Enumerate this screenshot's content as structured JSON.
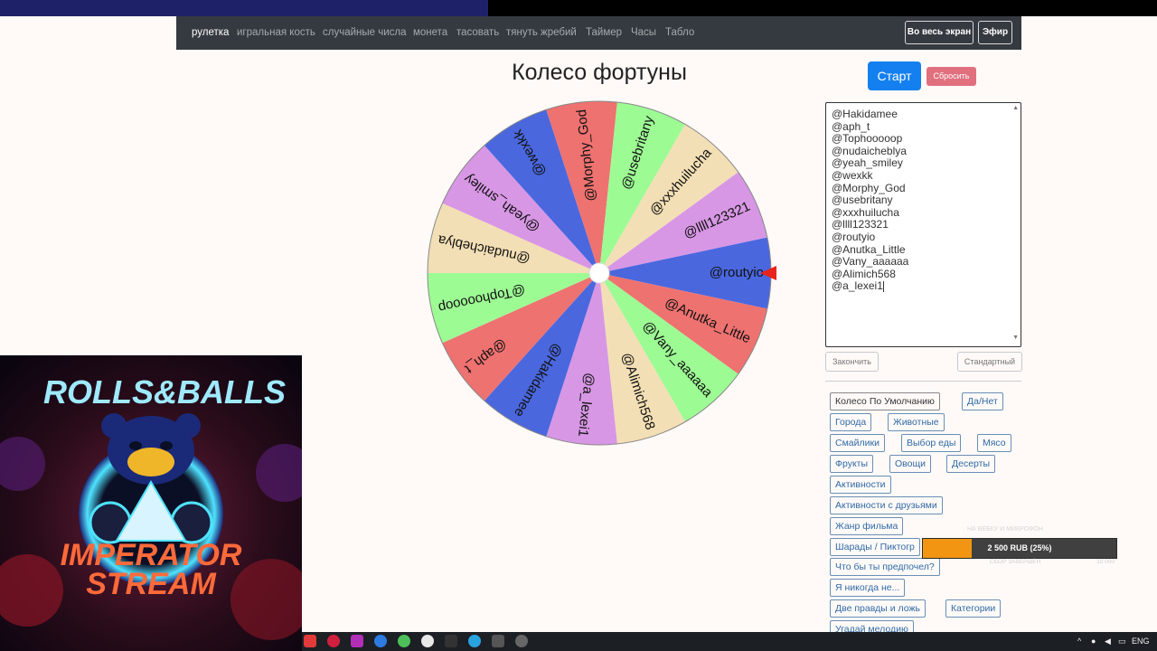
{
  "nav": {
    "items": [
      "рулетка",
      "игральная кость",
      "случайные числа",
      "монета",
      "тасовать",
      "тянуть жребий",
      "Таймер",
      "Часы",
      "Табло"
    ],
    "fullscreen_label": "Во весь экран",
    "broadcast_label": "Эфир"
  },
  "page": {
    "title": "Колесо фортуны"
  },
  "controls": {
    "start_label": "Старт",
    "reset_label": "Сбросить"
  },
  "names": [
    "@Hakidamee",
    "@aph_t",
    "@Tophooooop",
    "@nudaicheblya",
    "@yeah_smiley",
    "@wexkk",
    "@Morphy_God",
    "@usebritany",
    "@xxxhuilucha",
    "@llll123321",
    "@routyio",
    "@Anutka_Little",
    "@Vany_aaaaaa",
    "@Alimich568",
    "@a_lexei1"
  ],
  "actions": {
    "finish_label": "Закончить",
    "standard_label": "Стандартный"
  },
  "presets": [
    "Колесо По Умолчанию",
    "Да/Нет",
    "Города",
    "Животные",
    "Смайлики",
    "Выбор еды",
    "Мясо",
    "Фрукты",
    "Овощи",
    "Десерты",
    "Активности",
    "Активности с друзьями",
    "Жанр фильма",
    "Шарады / Пиктогр",
    "Что бы ты предпочел?",
    "Я никогда не...",
    "Две правды и ложь",
    "Категории",
    "Угадай мелодию"
  ],
  "wheel": {
    "segments": [
      {
        "label": "@routyio",
        "color": "#4a67de"
      },
      {
        "label": "@Anutka_Little",
        "color": "#ee7270"
      },
      {
        "label": "@Vany_aaaaaa",
        "color": "#9dfb94"
      },
      {
        "label": "@Alimich568",
        "color": "#f3dfb5"
      },
      {
        "label": "@a_lexei1",
        "color": "#d797e4"
      },
      {
        "label": "@Hakidamee",
        "color": "#4a67de"
      },
      {
        "label": "@aph_t",
        "color": "#ee7270"
      },
      {
        "label": "@Tophooooop",
        "color": "#9dfb94"
      },
      {
        "label": "@nudaicheblya",
        "color": "#f3dfb5"
      },
      {
        "label": "@yeah_smiley",
        "color": "#d797e4"
      },
      {
        "label": "@wexkk",
        "color": "#4a67de"
      },
      {
        "label": "@Morphy_God",
        "color": "#ee7270"
      },
      {
        "label": "@usebritany",
        "color": "#9dfb94"
      },
      {
        "label": "@xxxhuilucha",
        "color": "#f3dfb5"
      },
      {
        "label": "@llll123321",
        "color": "#d797e4"
      }
    ],
    "pointer_color": "#e8231c"
  },
  "stream": {
    "logo_top": "ROLLS&BALLS",
    "logo_bottom_1": "IMPERATOR",
    "logo_bottom_2": "STREAM"
  },
  "donation": {
    "goal_label": "НА ВЕБКУ И МИКРОФОН",
    "progress_text": "2 500 RUB (25%)",
    "progress": 0.25,
    "left_caption": "СБОР ЗАВЕРШЁН",
    "right_caption": "10 000"
  },
  "taskbar": {
    "lang": "ENG"
  }
}
